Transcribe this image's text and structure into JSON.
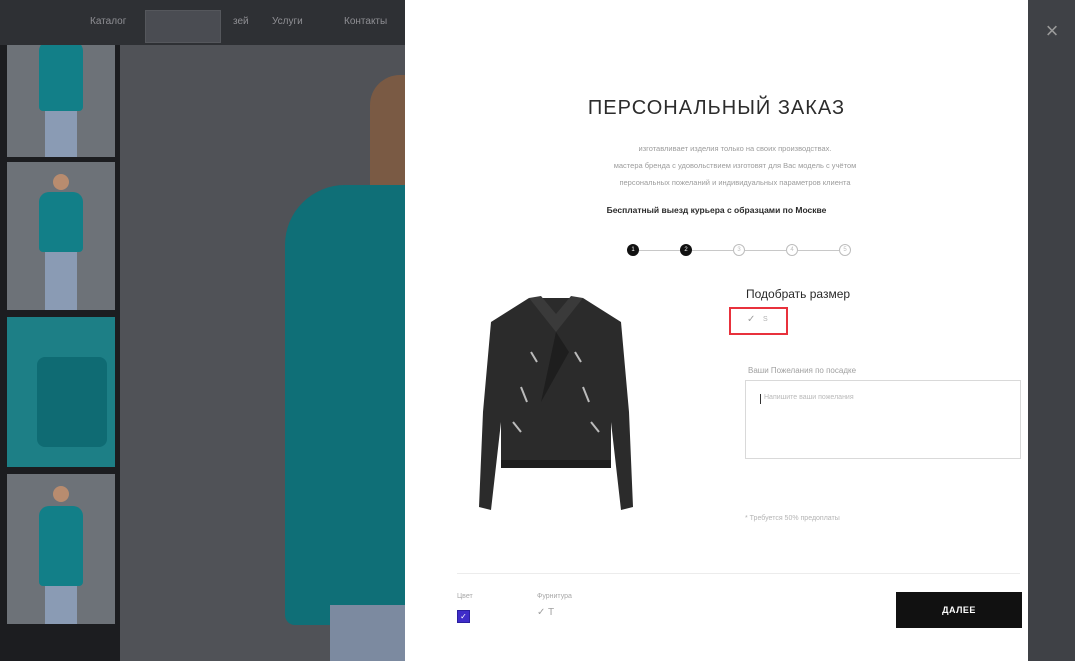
{
  "background": {
    "nav_links": [
      "Каталог",
      "зей",
      "Услуги",
      "Контакты"
    ]
  },
  "modal": {
    "title": "ПЕРСОНАЛЬНЫЙ ЗАКАЗ",
    "description_lines": [
      "изготавливает изделия только на своих производствах.",
      "мастера бренда с удовольствием изготовят для Вас модель с учётом",
      "персональных пожеланий и индивидуальных параметров клиента"
    ],
    "courier_note": "Бесплатный выезд курьера с образцами по Москве",
    "steps": [
      {
        "label": "1",
        "state": "done"
      },
      {
        "label": "2",
        "state": "done"
      },
      {
        "label": "3",
        "state": "todo"
      },
      {
        "label": "4",
        "state": "todo"
      },
      {
        "label": "5",
        "state": "todo"
      }
    ],
    "size_label": "Подобрать размер",
    "size_value": "S",
    "wishes_label": "Ваши Пожелания по посадке",
    "wishes_placeholder": "Напишите ваши пожелания",
    "footnote": "* Требуется 50% предоплаты",
    "color_label": "Цвет",
    "fittings_label": "Фурнитура",
    "fittings_value": "✓ T",
    "next_label": "ДАЛЕЕ",
    "close_label": "×",
    "accent_red": "#e8313c",
    "swatch_color": "#3f2cc9"
  }
}
